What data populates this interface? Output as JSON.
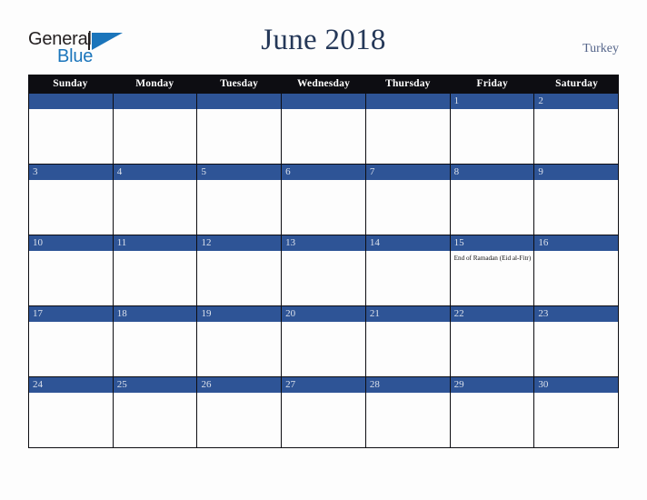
{
  "brand": {
    "logo_text_primary": "General",
    "logo_text_secondary": "Blue",
    "logo_mark": "triangle-mark"
  },
  "header": {
    "title": "June 2018",
    "country": "Turkey"
  },
  "colors": {
    "accent_blue": "#2e5496",
    "header_black": "#0d0d12",
    "title_navy": "#253858",
    "country_gray": "#55658a",
    "logo_blue": "#1b75bb",
    "page_background": "#fdfdfd"
  },
  "calendar": {
    "weekdays": [
      "Sunday",
      "Monday",
      "Tuesday",
      "Wednesday",
      "Thursday",
      "Friday",
      "Saturday"
    ],
    "weeks": [
      [
        {
          "day": "",
          "event": ""
        },
        {
          "day": "",
          "event": ""
        },
        {
          "day": "",
          "event": ""
        },
        {
          "day": "",
          "event": ""
        },
        {
          "day": "",
          "event": ""
        },
        {
          "day": "1",
          "event": ""
        },
        {
          "day": "2",
          "event": ""
        }
      ],
      [
        {
          "day": "3",
          "event": ""
        },
        {
          "day": "4",
          "event": ""
        },
        {
          "day": "5",
          "event": ""
        },
        {
          "day": "6",
          "event": ""
        },
        {
          "day": "7",
          "event": ""
        },
        {
          "day": "8",
          "event": ""
        },
        {
          "day": "9",
          "event": ""
        }
      ],
      [
        {
          "day": "10",
          "event": ""
        },
        {
          "day": "11",
          "event": ""
        },
        {
          "day": "12",
          "event": ""
        },
        {
          "day": "13",
          "event": ""
        },
        {
          "day": "14",
          "event": ""
        },
        {
          "day": "15",
          "event": "End of Ramadan (Eid al-Fitr)"
        },
        {
          "day": "16",
          "event": ""
        }
      ],
      [
        {
          "day": "17",
          "event": ""
        },
        {
          "day": "18",
          "event": ""
        },
        {
          "day": "19",
          "event": ""
        },
        {
          "day": "20",
          "event": ""
        },
        {
          "day": "21",
          "event": ""
        },
        {
          "day": "22",
          "event": ""
        },
        {
          "day": "23",
          "event": ""
        }
      ],
      [
        {
          "day": "24",
          "event": ""
        },
        {
          "day": "25",
          "event": ""
        },
        {
          "day": "26",
          "event": ""
        },
        {
          "day": "27",
          "event": ""
        },
        {
          "day": "28",
          "event": ""
        },
        {
          "day": "29",
          "event": ""
        },
        {
          "day": "30",
          "event": ""
        }
      ]
    ]
  }
}
